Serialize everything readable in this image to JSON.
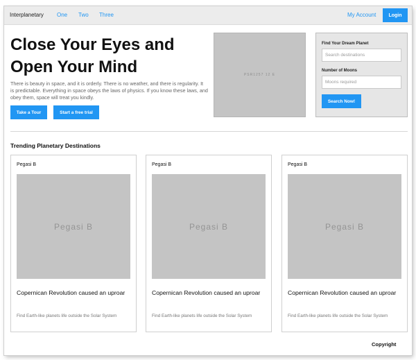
{
  "navbar": {
    "brand": "Interplanetary",
    "links": [
      "One",
      "Two",
      "Three"
    ],
    "account": "My Account",
    "login": "Login"
  },
  "hero": {
    "title": "Close Your Eyes and Open Your Mind",
    "text": "There is beauty in space, and it is orderly. There is no weather, and there is regularity. It is predictable. Everything in space obeys the laws of physics. If you know these laws, and obey them, space will treat you kindly.",
    "tour_button": "Take a Tour",
    "trial_button": "Start a free trial",
    "image_text": "PSR1257 12 E"
  },
  "search": {
    "planet_label": "Find Your Dream Planet",
    "planet_placeholder": "Search destinations",
    "moons_label": "Number of Moons",
    "moons_placeholder": "Moons required",
    "button": "Search Now!"
  },
  "trending": {
    "title": "Trending Planetary Destinations",
    "cards": [
      {
        "tag": "Pegasi B",
        "image_text": "Pegasi B",
        "headline": "Copernican Revolution caused an uproar",
        "text": "Find Earth-like planets life outside the Solar System"
      },
      {
        "tag": "Pegasi B",
        "image_text": "Pegasi B",
        "headline": "Copernican Revolution caused an uproar",
        "text": "Find Earth-like planets life outside the Solar System"
      },
      {
        "tag": "Pegasi B",
        "image_text": "Pegasi B",
        "headline": "Copernican Revolution caused an uproar",
        "text": "Find Earth-like planets life outside the Solar System"
      }
    ]
  },
  "footer": {
    "text": "Copyright"
  },
  "colors": {
    "accent": "#2196f3",
    "navbar_bg": "#ececec",
    "placeholder_gray": "#c4c4c4",
    "panel_bg": "#e6e6e6"
  }
}
